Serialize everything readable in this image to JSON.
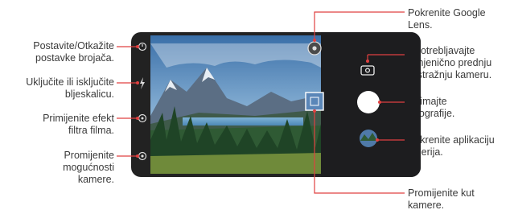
{
  "callouts": {
    "timer": [
      "Postavite/Otkažite",
      "postavke brojača."
    ],
    "flash": [
      "Uključite ili isključite",
      "bljeskalicu."
    ],
    "film_filter": [
      "Primijenite efekt",
      "filtra filma."
    ],
    "camera_options": [
      "Promijenite",
      "mogućnosti",
      "kamere."
    ],
    "google_lens": [
      "Pokrenite Google",
      "Lens."
    ],
    "switch_camera": [
      "Upotrebljavajte",
      "izmjenično prednju",
      "ili stražnju kameru."
    ],
    "capture": [
      "Snimajte",
      "fotografije."
    ],
    "gallery": [
      "Pokrenite aplikaciju",
      "galerija."
    ],
    "camera_angle": [
      "Promijenite kut",
      "kamere."
    ]
  },
  "icons": {
    "timer": "timer-icon",
    "flash": "flash-icon",
    "film_filter": "film-filter-icon",
    "camera_options": "settings-icon",
    "google_lens": "google-lens-icon",
    "switch_camera": "switch-camera-icon",
    "capture": "shutter-button",
    "gallery": "gallery-thumbnail",
    "camera_angle": "camera-angle-icon"
  },
  "colors": {
    "leader": "#e04040",
    "text": "#3a3a3a"
  }
}
